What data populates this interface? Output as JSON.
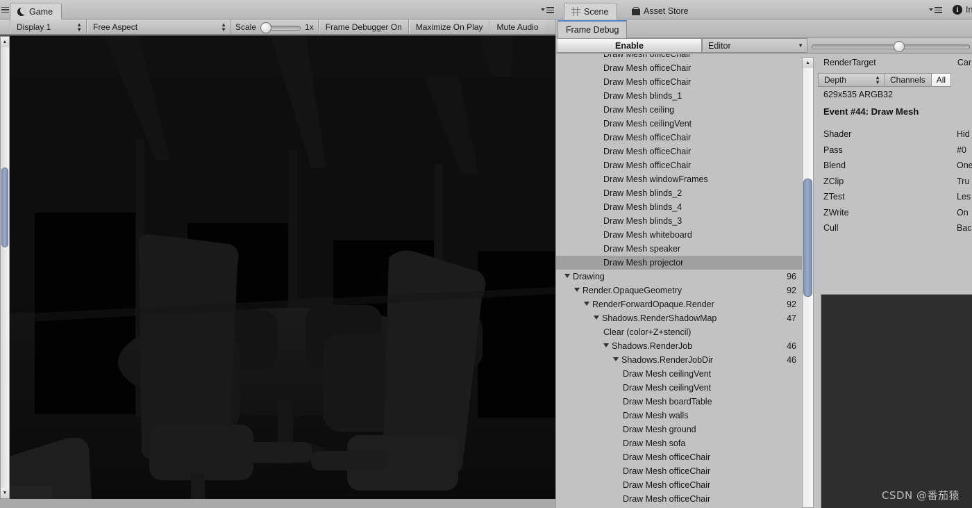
{
  "game_panel": {
    "tab_label": "Game",
    "tab_icon": "moon-icon",
    "toolbar": {
      "display_label": "Display 1",
      "aspect_label": "Free Aspect",
      "scale_label": "Scale",
      "scale_value": "1x",
      "frame_debugger_label": "Frame Debugger On",
      "maximize_label": "Maximize On Play",
      "mute_label": "Mute Audio"
    },
    "menu_icon": "kebab-menu-icon"
  },
  "scene_panel": {
    "tab_label": "Scene",
    "tab_icon": "grid-icon",
    "asset_store_label": "Asset Store",
    "asset_store_icon": "shopping-bag-icon",
    "menu_icon": "kebab-menu-icon"
  },
  "inspector_panel": {
    "info_icon": "info-icon",
    "tab_label": "In"
  },
  "frame_debug": {
    "tab_label": "Frame Debug",
    "enable_button": "Enable",
    "target_dropdown": "Editor",
    "slider_value": 55,
    "tree": [
      {
        "label": "Draw Mesh officeChair",
        "indent": 5,
        "count": "",
        "selected": false,
        "partial": true
      },
      {
        "label": "Draw Mesh officeChair",
        "indent": 5,
        "count": "",
        "selected": false
      },
      {
        "label": "Draw Mesh officeChair",
        "indent": 5,
        "count": "",
        "selected": false
      },
      {
        "label": "Draw Mesh blinds_1",
        "indent": 5,
        "count": "",
        "selected": false
      },
      {
        "label": "Draw Mesh ceiling",
        "indent": 5,
        "count": "",
        "selected": false
      },
      {
        "label": "Draw Mesh ceilingVent",
        "indent": 5,
        "count": "",
        "selected": false
      },
      {
        "label": "Draw Mesh officeChair",
        "indent": 5,
        "count": "",
        "selected": false
      },
      {
        "label": "Draw Mesh officeChair",
        "indent": 5,
        "count": "",
        "selected": false
      },
      {
        "label": "Draw Mesh officeChair",
        "indent": 5,
        "count": "",
        "selected": false
      },
      {
        "label": "Draw Mesh windowFrames",
        "indent": 5,
        "count": "",
        "selected": false
      },
      {
        "label": "Draw Mesh blinds_2",
        "indent": 5,
        "count": "",
        "selected": false
      },
      {
        "label": "Draw Mesh blinds_4",
        "indent": 5,
        "count": "",
        "selected": false
      },
      {
        "label": "Draw Mesh blinds_3",
        "indent": 5,
        "count": "",
        "selected": false
      },
      {
        "label": "Draw Mesh whiteboard",
        "indent": 5,
        "count": "",
        "selected": false
      },
      {
        "label": "Draw Mesh speaker",
        "indent": 5,
        "count": "",
        "selected": false
      },
      {
        "label": "Draw Mesh projector",
        "indent": 5,
        "count": "",
        "selected": true
      },
      {
        "label": "Drawing",
        "indent": 1,
        "count": "96",
        "selected": false,
        "triangle": "open"
      },
      {
        "label": "Render.OpaqueGeometry",
        "indent": 2,
        "count": "92",
        "selected": false,
        "triangle": "open"
      },
      {
        "label": "RenderForwardOpaque.Render",
        "indent": 3,
        "count": "92",
        "selected": false,
        "triangle": "open"
      },
      {
        "label": "Shadows.RenderShadowMap",
        "indent": 4,
        "count": "47",
        "selected": false,
        "triangle": "open"
      },
      {
        "label": "Clear (color+Z+stencil)",
        "indent": 5,
        "count": "",
        "selected": false
      },
      {
        "label": "Shadows.RenderJob",
        "indent": 5,
        "count": "46",
        "selected": false,
        "triangle": "open"
      },
      {
        "label": "Shadows.RenderJobDir",
        "indent": 6,
        "count": "46",
        "selected": false,
        "triangle": "open"
      },
      {
        "label": "Draw Mesh ceilingVent",
        "indent": 7,
        "count": "",
        "selected": false
      },
      {
        "label": "Draw Mesh ceilingVent",
        "indent": 7,
        "count": "",
        "selected": false
      },
      {
        "label": "Draw Mesh boardTable",
        "indent": 7,
        "count": "",
        "selected": false
      },
      {
        "label": "Draw Mesh walls",
        "indent": 7,
        "count": "",
        "selected": false
      },
      {
        "label": "Draw Mesh ground",
        "indent": 7,
        "count": "",
        "selected": false
      },
      {
        "label": "Draw Mesh sofa",
        "indent": 7,
        "count": "",
        "selected": false
      },
      {
        "label": "Draw Mesh officeChair",
        "indent": 7,
        "count": "",
        "selected": false
      },
      {
        "label": "Draw Mesh officeChair",
        "indent": 7,
        "count": "",
        "selected": false
      },
      {
        "label": "Draw Mesh officeChair",
        "indent": 7,
        "count": "",
        "selected": false
      },
      {
        "label": "Draw Mesh officeChair",
        "indent": 7,
        "count": "",
        "selected": false
      }
    ],
    "detail": {
      "render_target_label": "RenderTarget",
      "camera_label": "Car",
      "depth_dropdown": "Depth",
      "channels_label": "Channels",
      "channels_value": "All",
      "size_format": "629x535 ARGB32",
      "event_title": "Event #44: Draw Mesh",
      "properties": [
        {
          "key": "Shader",
          "value": "Hid"
        },
        {
          "key": "Pass",
          "value": "#0"
        },
        {
          "key": "Blend",
          "value": "One"
        },
        {
          "key": "ZClip",
          "value": "Tru"
        },
        {
          "key": "ZTest",
          "value": "Les"
        },
        {
          "key": "ZWrite",
          "value": "On"
        },
        {
          "key": "Cull",
          "value": "Bac"
        }
      ]
    }
  },
  "watermark": "CSDN @番茄猿",
  "colors": {
    "panel": "#c2c2c2",
    "toolbar": "#c0c0c0",
    "selection": "#a0a0a0",
    "scrollbar_thumb": "#8193b4",
    "tab_accent": "#5b85c6",
    "game_bg": "#0b0b0b",
    "preview_bg": "#2e2e2e"
  }
}
